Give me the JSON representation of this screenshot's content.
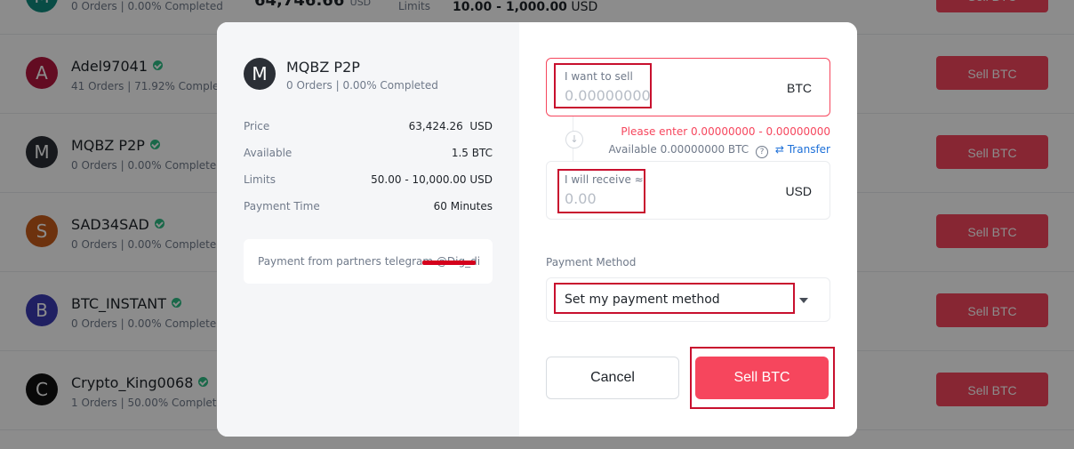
{
  "background": {
    "top_partial": {
      "stats": "0 Orders | 0.00% Completed",
      "price_fragment": "64,746.66",
      "price_unit": "USD",
      "limits_label": "Limits",
      "limits_value": "10.00 - 1,000.00",
      "limits_unit": "USD"
    },
    "rows": [
      {
        "initial": "A",
        "name": "Adel97041",
        "stats": "41 Orders | 71.92% Completed",
        "color": "#b5163f",
        "button": "Sell BTC"
      },
      {
        "initial": "M",
        "name": "MQBZ P2P",
        "stats": "0 Orders | 0.00% Completed",
        "color": "#2b2f36",
        "button": "Sell BTC"
      },
      {
        "initial": "S",
        "name": "SAD34SAD",
        "stats": "0 Orders | 0.00% Completed",
        "color": "#c75b1a",
        "button": "Sell BTC"
      },
      {
        "initial": "B",
        "name": "BTC_INSTANT",
        "stats": "0 Orders | 0.00% Completed",
        "color": "#3b3bb3",
        "button": "Sell BTC"
      },
      {
        "initial": "C",
        "name": "Crypto_King0068",
        "stats": "1 Orders | 50.00% Completed",
        "color": "#111111",
        "button": "Sell BTC"
      }
    ]
  },
  "modal": {
    "merchant": {
      "initial": "M",
      "name": "MQBZ P2P",
      "stats": "0 Orders | 0.00% Completed"
    },
    "info": {
      "price_label": "Price",
      "price_value": "63,424.26",
      "price_unit": "USD",
      "available_label": "Available",
      "available_value": "1.5 BTC",
      "limits_label": "Limits",
      "limits_value": "50.00 - 10,000.00 USD",
      "payment_time_label": "Payment Time",
      "payment_time_value": "60 Minutes"
    },
    "remark": "Payment from partners telegram @Dig_di",
    "sell_field": {
      "label": "I want to sell",
      "placeholder": "0.00000000",
      "unit": "BTC"
    },
    "error_message": "Please enter 0.00000000 - 0.00000000",
    "available": {
      "label": "Available",
      "value": "0.00000000 BTC",
      "help_icon": "question-circle-icon",
      "transfer_icon": "transfer-icon",
      "transfer_label": "Transfer"
    },
    "receive_field": {
      "label": "I will receive ≈",
      "placeholder": "0.00",
      "unit": "USD"
    },
    "payment_method": {
      "label": "Payment Method",
      "selected": "Set my payment method"
    },
    "buttons": {
      "cancel": "Cancel",
      "sell": "Sell BTC"
    },
    "colors": {
      "sell": "#f6465d",
      "verified": "#2ebd85",
      "highlight": "#c8102e",
      "link": "#1c6fd8"
    }
  }
}
